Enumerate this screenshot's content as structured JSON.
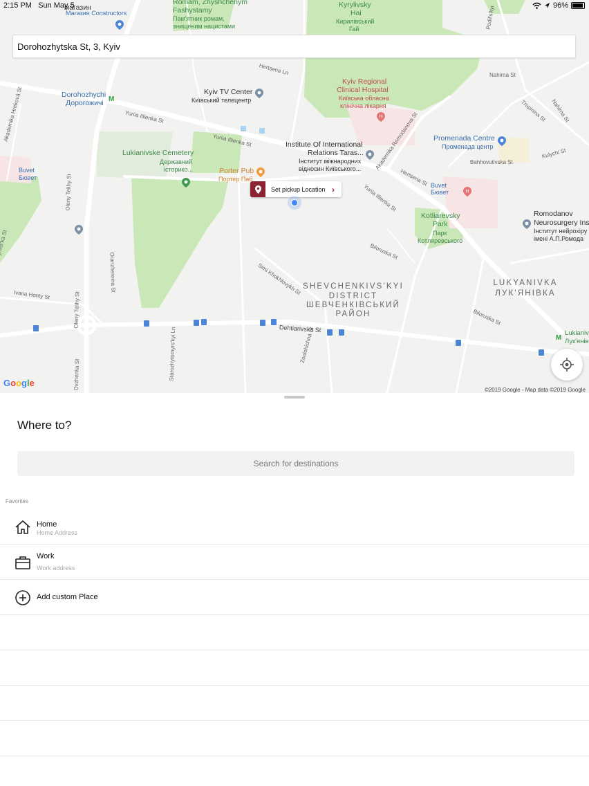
{
  "status_bar": {
    "time": "2:15 PM",
    "date": "Sun May 5",
    "battery": "96%"
  },
  "address_bar": {
    "value": "Dorohozhytska St,  3,  Kyiv"
  },
  "map": {
    "pickup_label": "Set pickup Location",
    "google_logo": "Google",
    "copyright": "©2019 Google - Map data ©2019 Google",
    "labels": {
      "magazin1": "магазин",
      "magazin2": "Магазин Constructors",
      "roman1": "Romam, Zhyshchenym",
      "roman2": "Fashystamy",
      "roman3": "Пам'ятник ромам,",
      "roman4": "знищеним нацистами",
      "kyr1": "Kyrylivsky",
      "kyr2": "Hai",
      "kyr3": "Кирилівський",
      "kyr4": "Гай",
      "regional1": "Kyiv Regional",
      "regional2": "Clinical Hospital",
      "regional3": "Київська обласна",
      "regional4": "клінічна лікарня",
      "tv1": "Kyiv TV Center",
      "tv2": "Київський телецентр",
      "dor1": "Dorohozhychi",
      "dor2": "Дорогожичі",
      "inst1": "Institute Of International",
      "inst2": "Relations Taras...",
      "inst3": "Інститут міжнародних",
      "inst4": "відносин Київського...",
      "prom1": "Promenada Centre",
      "prom2": "Променада центр",
      "cem1": "Lukianivske Cemetery",
      "cem2": "Державний",
      "cem3": "історико...",
      "porter1": "Porter Pub",
      "porter2": "Портер Паб",
      "buvet1a": "Buvet",
      "buvet1b": "Бювет",
      "buvet2a": "Buvet",
      "buvet2b": "Бювет",
      "kotl1": "Kotliarevsky",
      "kotl2": "Park",
      "kotl3": "Парк",
      "kotl4": "Котляревського",
      "romod1": "Romodanov",
      "romod2": "Neurosurgery Insi",
      "romod3": "Інститут нейрохіру",
      "romod4": "імені А.П.Ромода",
      "shev1": "SHEVCHENKIVS'KYI",
      "shev2": "DISTRICT",
      "shev3": "ШЕВЧЕНКІВСЬКИЙ",
      "shev4": "РАЙОН",
      "luk1": "LUKYANIVKA",
      "luk2": "ЛУК'ЯНІВКА",
      "lukst1": "Lukianiv",
      "lukst2": "Лук'янів"
    },
    "streets": {
      "illienka1": "Yuriia Illienka St",
      "illienka2": "Yuriia Illienka St",
      "illienka3": "Yuriia Illienka St",
      "dehtiarivska": "Dehtiarivska St",
      "telihy": "Oleny Telihy St",
      "telihy2": "Oleny Telihy St",
      "herts": "Hertsena Ln",
      "hertsena": "Hertsena St",
      "akad": "Akademika Romodanova St",
      "nahirna": "Nahirna St",
      "khokhlovykh": "Simi Khokhlovykh St",
      "orani": "Oranzhereina St",
      "bilo": "Biloruska St",
      "bilo2": "Biloruska St",
      "zood": "Zoolohichna St",
      "ivan": "Ivana Honty St",
      "bahh": "Bahhovutivska St",
      "kulik": "Kulychi St",
      "tropin": "Tropinina St",
      "heroiv": "Akademika Hreková St",
      "naberezh": "Parkovo-Syrets'ka St",
      "starozh": "Starozhytomyrs'kyi Ln",
      "ovz": "Ovzhenka St",
      "podil": "Podil's'kyi",
      "nahirna2": "Nahirna St"
    }
  },
  "sheet": {
    "title": "Where to?",
    "search_placeholder": "Search for destinations",
    "favorites_label": "Favorites",
    "home": {
      "title": "Home",
      "subtitle": "Home Address"
    },
    "work": {
      "title": "Work",
      "subtitle": "Work address"
    },
    "custom": {
      "title": "Add custom Place"
    }
  },
  "colors": {
    "accent": "#8c2333",
    "map_bg": "#f2f2f0",
    "park": "#c9e7b7",
    "road": "#ffffff"
  }
}
